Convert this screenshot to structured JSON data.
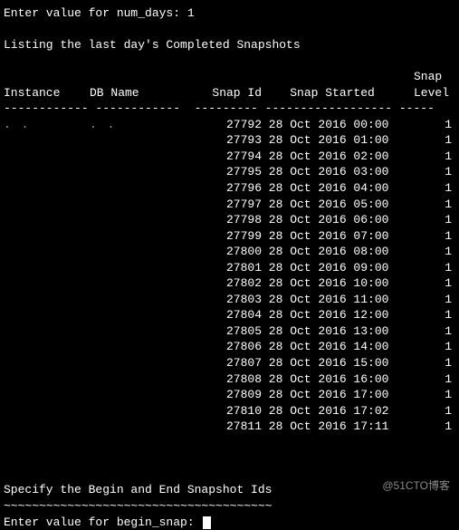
{
  "prompts": {
    "num_days_label": "Enter value for num_days: ",
    "num_days_value": "1",
    "begin_snap_label": "Enter value for begin_snap: "
  },
  "listing_title": "Listing the last day's Completed Snapshots",
  "headers": {
    "instance": "Instance",
    "db_name": "DB Name",
    "snap_id": "Snap Id",
    "snap_started": "Snap Started",
    "snap_level_1": "Snap",
    "snap_level_2": "Level"
  },
  "instance_value": ". .",
  "dbname_value": ". .",
  "rows": [
    {
      "snap_id": "27792",
      "started": "28 Oct 2016 00:00",
      "level": "1"
    },
    {
      "snap_id": "27793",
      "started": "28 Oct 2016 01:00",
      "level": "1"
    },
    {
      "snap_id": "27794",
      "started": "28 Oct 2016 02:00",
      "level": "1"
    },
    {
      "snap_id": "27795",
      "started": "28 Oct 2016 03:00",
      "level": "1"
    },
    {
      "snap_id": "27796",
      "started": "28 Oct 2016 04:00",
      "level": "1"
    },
    {
      "snap_id": "27797",
      "started": "28 Oct 2016 05:00",
      "level": "1"
    },
    {
      "snap_id": "27798",
      "started": "28 Oct 2016 06:00",
      "level": "1"
    },
    {
      "snap_id": "27799",
      "started": "28 Oct 2016 07:00",
      "level": "1"
    },
    {
      "snap_id": "27800",
      "started": "28 Oct 2016 08:00",
      "level": "1"
    },
    {
      "snap_id": "27801",
      "started": "28 Oct 2016 09:00",
      "level": "1"
    },
    {
      "snap_id": "27802",
      "started": "28 Oct 2016 10:00",
      "level": "1"
    },
    {
      "snap_id": "27803",
      "started": "28 Oct 2016 11:00",
      "level": "1"
    },
    {
      "snap_id": "27804",
      "started": "28 Oct 2016 12:00",
      "level": "1"
    },
    {
      "snap_id": "27805",
      "started": "28 Oct 2016 13:00",
      "level": "1"
    },
    {
      "snap_id": "27806",
      "started": "28 Oct 2016 14:00",
      "level": "1"
    },
    {
      "snap_id": "27807",
      "started": "28 Oct 2016 15:00",
      "level": "1"
    },
    {
      "snap_id": "27808",
      "started": "28 Oct 2016 16:00",
      "level": "1"
    },
    {
      "snap_id": "27809",
      "started": "28 Oct 2016 17:00",
      "level": "1"
    },
    {
      "snap_id": "27810",
      "started": "28 Oct 2016 17:02",
      "level": "1"
    },
    {
      "snap_id": "27811",
      "started": "28 Oct 2016 17:11",
      "level": "1"
    }
  ],
  "specify_title": "Specify the Begin and End Snapshot Ids",
  "section_dashes": "~~~~~~~~~~~~~~~~~~~~~~~~~~~~~~~~~~~~~~",
  "watermark": "@51CTO博客"
}
